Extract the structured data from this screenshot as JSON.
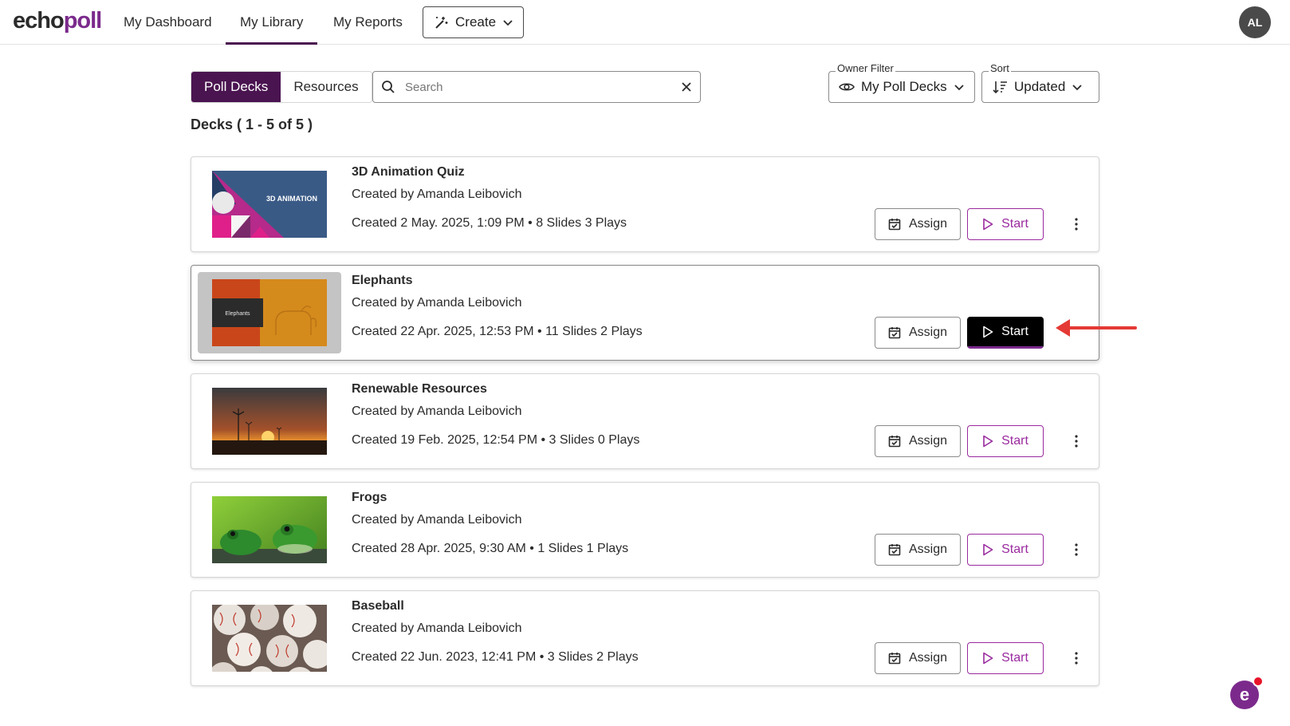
{
  "brand": {
    "logo_part1": "echo",
    "logo_part2": "poll"
  },
  "nav": {
    "dashboard": "My Dashboard",
    "library": "My Library",
    "reports": "My Reports",
    "create": "Create"
  },
  "user": {
    "initials": "AL"
  },
  "toolbar": {
    "tab_poll_decks": "Poll Decks",
    "tab_resources": "Resources",
    "search_placeholder": "Search",
    "owner_filter_label": "Owner Filter",
    "owner_filter_value": "My Poll Decks",
    "sort_label": "Sort",
    "sort_value": "Updated"
  },
  "deck_count": "Decks ( 1 - 5 of 5 )",
  "actions": {
    "assign": "Assign",
    "start": "Start"
  },
  "decks": [
    {
      "title": "3D Animation Quiz",
      "creator": "Created by Amanda Leibovich",
      "meta": "Created 2 May. 2025, 1:09 PM • 8 Slides 3 Plays",
      "thumb_text": "3D ANIMATION"
    },
    {
      "title": "Elephants",
      "creator": "Created by Amanda Leibovich",
      "meta": "Created 22 Apr. 2025, 12:53 PM • 11 Slides 2 Plays",
      "thumb_text": "Elephants"
    },
    {
      "title": "Renewable Resources",
      "creator": "Created by Amanda Leibovich",
      "meta": "Created 19 Feb. 2025, 12:54 PM • 3 Slides 0 Plays"
    },
    {
      "title": "Frogs",
      "creator": "Created by Amanda Leibovich",
      "meta": "Created 28 Apr. 2025, 9:30 AM • 1 Slides 1 Plays"
    },
    {
      "title": "Baseball",
      "creator": "Created by Amanda Leibovich",
      "meta": "Created 22 Jun. 2023, 12:41 PM • 3 Slides 2 Plays"
    }
  ],
  "colors": {
    "brand_purple": "#7b2a8c",
    "dark_purple": "#4a1450",
    "arrow_red": "#e53935"
  },
  "help": {
    "letter": "e"
  }
}
